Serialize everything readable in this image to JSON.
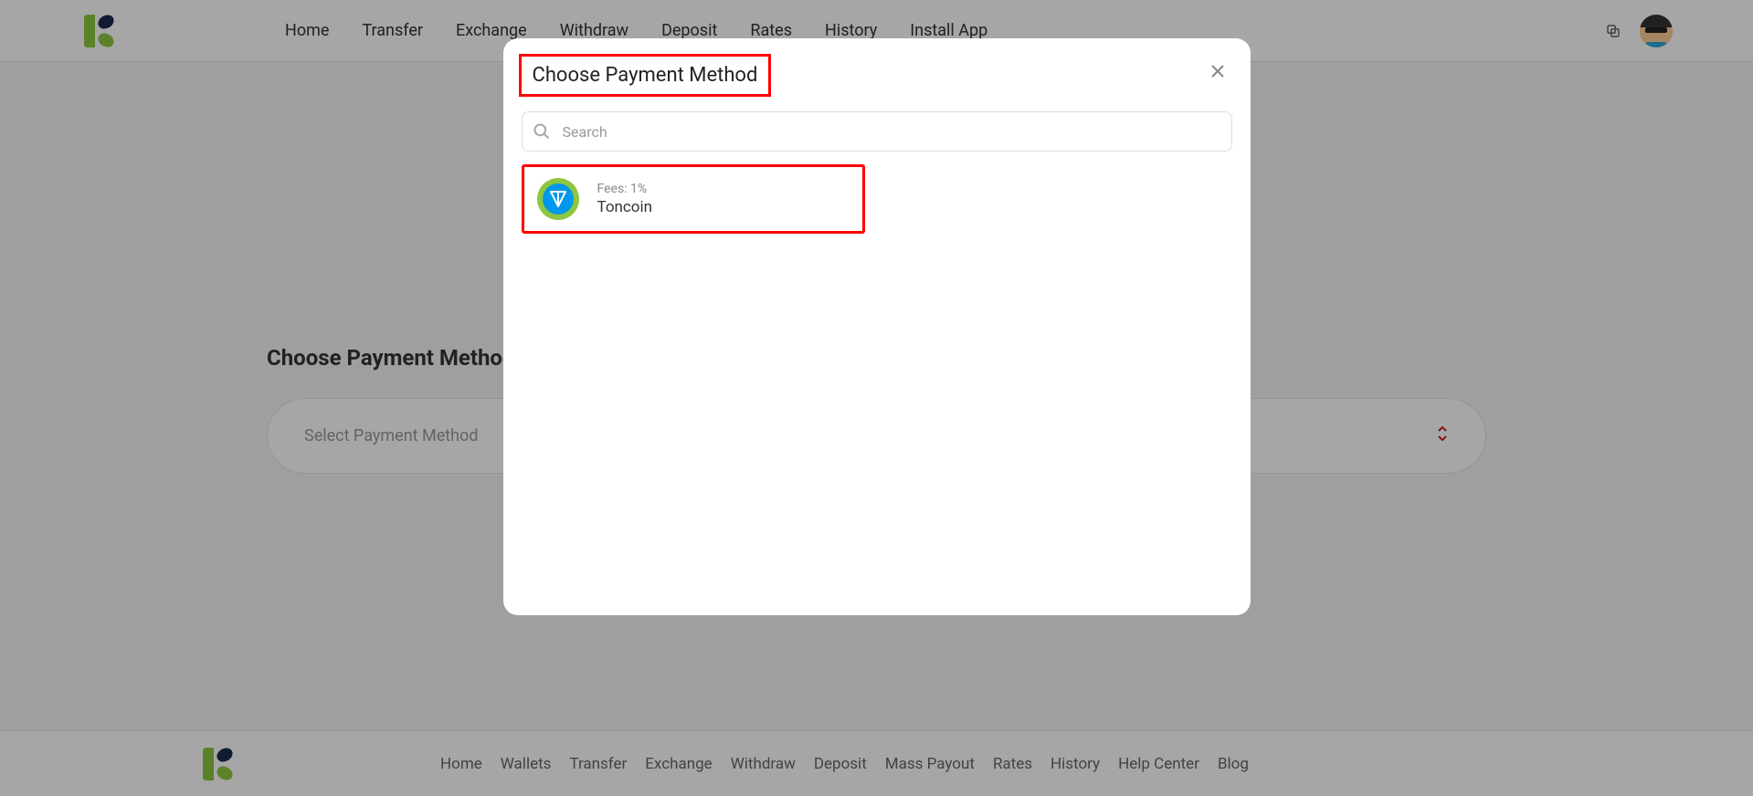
{
  "header": {
    "nav": [
      "Home",
      "Transfer",
      "Exchange",
      "Withdraw",
      "Deposit",
      "Rates",
      "History",
      "Install App"
    ]
  },
  "main": {
    "page_title": "Choose Payment Method",
    "select_placeholder": "Select Payment Method"
  },
  "modal": {
    "title": "Choose Payment Method",
    "search_placeholder": "Search",
    "options": [
      {
        "fees_label": "Fees:",
        "fees_value": "1%",
        "name": "Toncoin"
      }
    ]
  },
  "footer": {
    "nav": [
      "Home",
      "Wallets",
      "Transfer",
      "Exchange",
      "Withdraw",
      "Deposit",
      "Mass Payout",
      "Rates",
      "History",
      "Help Center",
      "Blog"
    ]
  }
}
